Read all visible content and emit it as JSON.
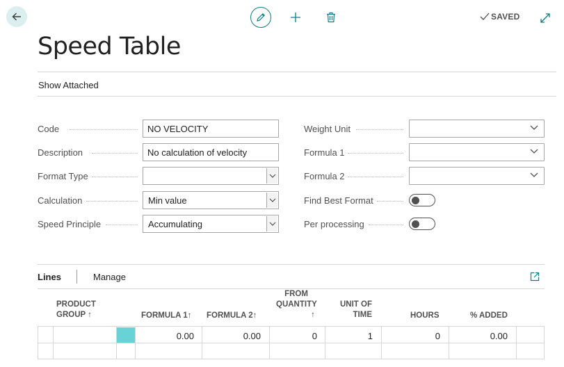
{
  "page": {
    "title": "Speed Table",
    "status": "SAVED",
    "show_attached": "Show Attached"
  },
  "toolbar": {
    "icons": [
      "back-arrow-icon",
      "pencil-icon",
      "plus-icon",
      "trash-icon",
      "check-icon",
      "expand-icon"
    ]
  },
  "fields_left": [
    {
      "label": "Code",
      "value": "NO VELOCITY",
      "kind": "text"
    },
    {
      "label": "Description",
      "value": "No calculation of velocity",
      "kind": "text"
    },
    {
      "label": "Format Type",
      "value": "",
      "kind": "select"
    },
    {
      "label": "Calculation",
      "value": "Min value",
      "kind": "select"
    },
    {
      "label": "Speed Principle",
      "value": "Accumulating",
      "kind": "select"
    }
  ],
  "fields_right": [
    {
      "label": "Weight Unit",
      "value": "",
      "kind": "dropdown"
    },
    {
      "label": "Formula 1",
      "value": "",
      "kind": "dropdown"
    },
    {
      "label": "Formula 2",
      "value": "",
      "kind": "dropdown"
    },
    {
      "label": "Find Best Format",
      "value": false,
      "kind": "toggle"
    },
    {
      "label": "Per processing",
      "value": false,
      "kind": "toggle"
    }
  ],
  "lines": {
    "tab_label": "Lines",
    "manage_label": "Manage",
    "columns": {
      "product_group_1": "PRODUCT",
      "product_group_2": "GROUP ↑",
      "formula1": "FORMULA 1↑",
      "formula2": "FORMULA 2↑",
      "from_quantity_1": "FROM",
      "from_quantity_2": "QUANTITY",
      "from_quantity_3": "↑",
      "unit_of_time_1": "UNIT OF",
      "unit_of_time_2": "TIME",
      "hours": "HOURS",
      "pct_added": "% ADDED"
    },
    "rows": [
      {
        "product_group": "",
        "formula1": "0.00",
        "formula2": "0.00",
        "from_quantity": "0",
        "unit_of_time": "1",
        "hours": "0",
        "pct_added": "0.00"
      }
    ]
  },
  "colors": {
    "accent": "#0d7c84",
    "back_button_bg": "#dbeef0",
    "selected_cell": "#68d2d6"
  }
}
